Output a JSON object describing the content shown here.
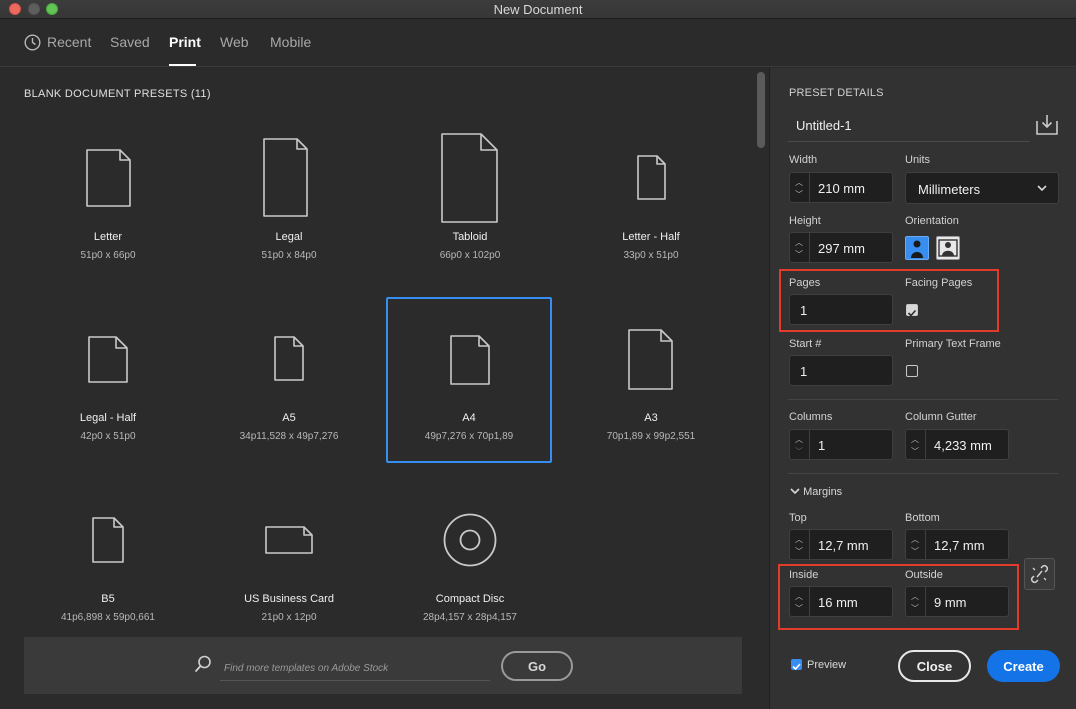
{
  "window": {
    "title": "New Document"
  },
  "tabs": [
    {
      "label": "Recent",
      "icon": "clock-icon"
    },
    {
      "label": "Saved"
    },
    {
      "label": "Print",
      "active": true
    },
    {
      "label": "Web"
    },
    {
      "label": "Mobile"
    }
  ],
  "presets": {
    "heading": "BLANK DOCUMENT PRESETS",
    "count": "(11)",
    "items": [
      {
        "name": "Letter",
        "size": "51p0 x 66p0",
        "icon": "page-icon"
      },
      {
        "name": "Legal",
        "size": "51p0 x 84p0",
        "icon": "page-icon"
      },
      {
        "name": "Tabloid",
        "size": "66p0 x 102p0",
        "icon": "page-icon"
      },
      {
        "name": "Letter - Half",
        "size": "33p0 x 51p0",
        "icon": "page-icon"
      },
      {
        "name": "Legal - Half",
        "size": "42p0 x 51p0",
        "icon": "page-icon"
      },
      {
        "name": "A5",
        "size": "34p11,528 x 49p7,276",
        "icon": "page-icon"
      },
      {
        "name": "A4",
        "size": "49p7,276 x 70p1,89",
        "icon": "page-icon",
        "selected": true
      },
      {
        "name": "A3",
        "size": "70p1,89 x 99p2,551",
        "icon": "page-icon"
      },
      {
        "name": "B5",
        "size": "41p6,898 x 59p0,661",
        "icon": "page-icon"
      },
      {
        "name": "US Business Card",
        "size": "21p0 x 12p0",
        "icon": "business-card-icon"
      },
      {
        "name": "Compact Disc",
        "size": "28p4,157 x 28p4,157",
        "icon": "compact-disc-icon"
      }
    ]
  },
  "search": {
    "placeholder": "Find more templates on Adobe Stock",
    "go_label": "Go"
  },
  "details": {
    "heading": "PRESET DETAILS",
    "doc_name": "Untitled-1",
    "width_label": "Width",
    "width_value": "210 mm",
    "units_label": "Units",
    "units_value": "Millimeters",
    "height_label": "Height",
    "height_value": "297 mm",
    "orientation_label": "Orientation",
    "orientation_value": "portrait",
    "pages_label": "Pages",
    "pages_value": "1",
    "facing_label": "Facing Pages",
    "facing_checked": true,
    "start_label": "Start #",
    "start_value": "1",
    "primary_label": "Primary Text Frame",
    "primary_checked": false,
    "columns_label": "Columns",
    "columns_value": "1",
    "gutter_label": "Column Gutter",
    "gutter_value": "4,233 mm",
    "margins_label": "Margins",
    "top_label": "Top",
    "top_value": "12,7 mm",
    "bottom_label": "Bottom",
    "bottom_value": "12,7 mm",
    "inside_label": "Inside",
    "inside_value": "16 mm",
    "outside_label": "Outside",
    "outside_value": "9 mm"
  },
  "footer": {
    "preview_label": "Preview",
    "preview_checked": true,
    "close_label": "Close",
    "create_label": "Create"
  },
  "colors": {
    "accent": "#1473e6",
    "selection": "#378ef0",
    "highlight": "#e23b2b"
  }
}
